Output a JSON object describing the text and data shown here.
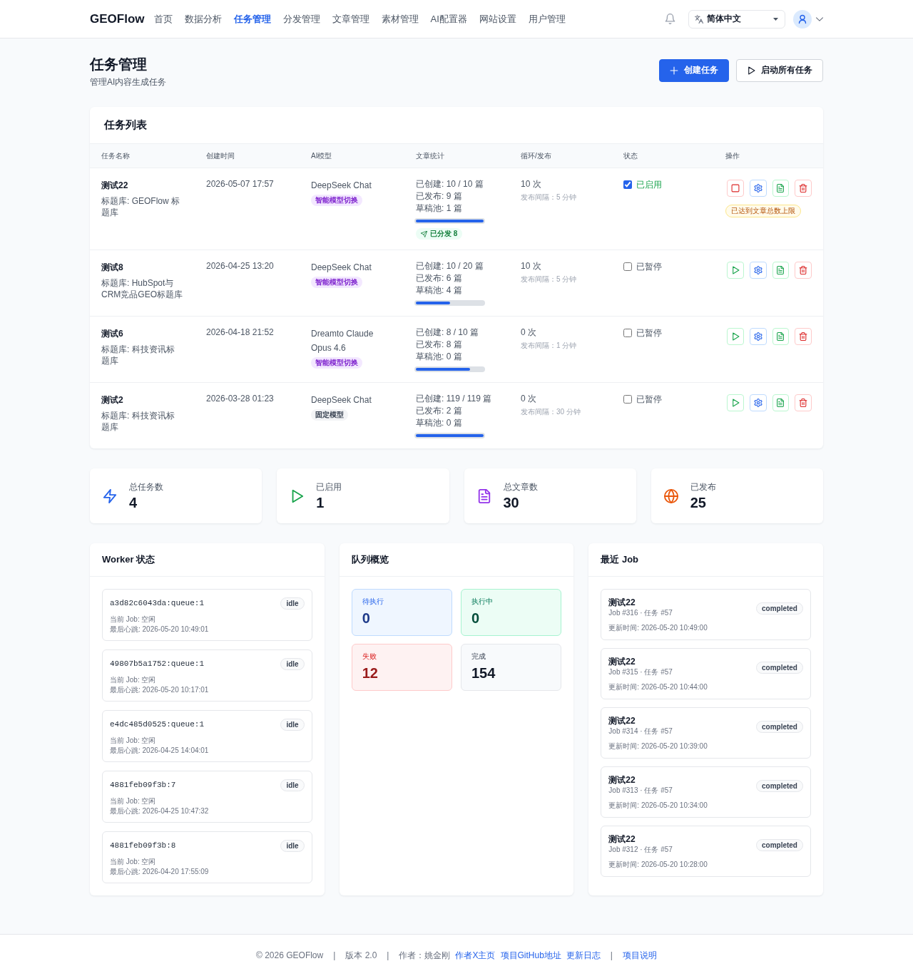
{
  "nav": {
    "logo": "GEOFlow",
    "items": [
      {
        "label": "首页",
        "selected": false
      },
      {
        "label": "数据分析",
        "selected": false
      },
      {
        "label": "任务管理",
        "selected": true
      },
      {
        "label": "分发管理",
        "selected": false
      },
      {
        "label": "文章管理",
        "selected": false
      },
      {
        "label": "素材管理",
        "selected": false
      },
      {
        "label": "AI配置器",
        "selected": false
      },
      {
        "label": "网站设置",
        "selected": false
      },
      {
        "label": "用户管理",
        "selected": false
      }
    ],
    "language": "简体中文"
  },
  "header": {
    "title": "任务管理",
    "subtitle": "管理AI内容生成任务",
    "buttons": [
      {
        "label": "创建任务",
        "kind": "primary"
      },
      {
        "label": "启动所有任务",
        "kind": "secondary"
      }
    ]
  },
  "task_table": {
    "title": "任务列表",
    "columns": [
      "任务名称",
      "创建时间",
      "AI模型",
      "文章统计",
      "循环/发布",
      "状态",
      "操作"
    ],
    "rows": [
      {
        "name": "测试22",
        "library": "标题库: GEOFlow 标题库",
        "created": "2026-05-07 17:57",
        "model": "DeepSeek Chat",
        "model_tag": {
          "label": "智能模型切换",
          "kind": "smart"
        },
        "stats": [
          "已创建: 10 / 10 篇",
          "已发布: 9 篇",
          "草稿池: 1 篇"
        ],
        "level": 1,
        "distributed": "已分发 8",
        "cycles": "10 次",
        "interval": "发布间隔：5 分钟",
        "enabled": true,
        "status": "已启用",
        "notice": "已达到文章总数上限"
      },
      {
        "name": "测试8",
        "library": "标题库: HubSpot与CRM竞品GEO标题库",
        "created": "2026-04-25 13:20",
        "model": "DeepSeek Chat",
        "model_tag": {
          "label": "智能模型切换",
          "kind": "smart"
        },
        "stats": [
          "已创建: 10 / 20 篇",
          "已发布: 6 篇",
          "草稿池: 4 篇"
        ],
        "level": 0.5,
        "cycles": "10 次",
        "interval": "发布间隔：5 分钟",
        "enabled": false,
        "status": "已暂停"
      },
      {
        "name": "测试6",
        "library": "标题库: 科技资讯标题库",
        "created": "2026-04-18 21:52",
        "model": "Dreamto Claude Opus 4.6",
        "model_tag": {
          "label": "智能模型切换",
          "kind": "smart"
        },
        "stats": [
          "已创建: 8 / 10 篇",
          "已发布: 8 篇",
          "草稿池: 0 篇"
        ],
        "level": 0.8,
        "cycles": "0 次",
        "interval": "发布间隔：1 分钟",
        "enabled": false,
        "status": "已暂停"
      },
      {
        "name": "测试2",
        "library": "标题库: 科技资讯标题库",
        "created": "2026-03-28 01:23",
        "model": "DeepSeek Chat",
        "model_tag": {
          "label": "固定模型",
          "kind": "fixed"
        },
        "stats": [
          "已创建: 119 / 119 篇",
          "已发布: 2 篇",
          "草稿池: 0 篇"
        ],
        "level": 1,
        "cycles": "0 次",
        "interval": "发布间隔：30 分钟",
        "enabled": false,
        "status": "已暂停"
      }
    ]
  },
  "summary_cards": [
    {
      "label": "总任务数",
      "value": "4",
      "kind": "tasks"
    },
    {
      "label": "已启用",
      "value": "1",
      "kind": "enabled"
    },
    {
      "label": "总文章数",
      "value": "30",
      "kind": "articles"
    },
    {
      "label": "已发布",
      "value": "25",
      "kind": "published"
    }
  ],
  "workers": {
    "title": "Worker 状态",
    "items": [
      {
        "id": "a3d82c6043da:queue:1",
        "state": "idle",
        "job": "当前 Job: 空闲",
        "heartbeat": "最后心跳: 2026-05-20 10:49:01"
      },
      {
        "id": "49807b5a1752:queue:1",
        "state": "idle",
        "job": "当前 Job: 空闲",
        "heartbeat": "最后心跳: 2026-05-20 10:17:01"
      },
      {
        "id": "e4dc485d0525:queue:1",
        "state": "idle",
        "job": "当前 Job: 空闲",
        "heartbeat": "最后心跳: 2026-04-25 14:04:01"
      },
      {
        "id": "4881feb09f3b:7",
        "state": "idle",
        "job": "当前 Job: 空闲",
        "heartbeat": "最后心跳: 2026-04-25 10:47:32"
      },
      {
        "id": "4881feb09f3b:8",
        "state": "idle",
        "job": "当前 Job: 空闲",
        "heartbeat": "最后心跳: 2026-04-20 17:55:09"
      }
    ]
  },
  "queue": {
    "title": "队列概览",
    "items": [
      {
        "label": "待执行",
        "value": "0",
        "kind": "pending"
      },
      {
        "label": "执行中",
        "value": "0",
        "kind": "running"
      },
      {
        "label": "失败",
        "value": "12",
        "kind": "failed"
      },
      {
        "label": "完成",
        "value": "154",
        "kind": "completed"
      }
    ]
  },
  "recent_jobs": {
    "title": "最近 Job",
    "items": [
      {
        "name": "测试22",
        "meta": "Job #316 · 任务 #57",
        "updated": "更新时间: 2026-05-20 10:49:00",
        "state": "completed"
      },
      {
        "name": "测试22",
        "meta": "Job #315 · 任务 #57",
        "updated": "更新时间: 2026-05-20 10:44:00",
        "state": "completed"
      },
      {
        "name": "测试22",
        "meta": "Job #314 · 任务 #57",
        "updated": "更新时间: 2026-05-20 10:39:00",
        "state": "completed"
      },
      {
        "name": "测试22",
        "meta": "Job #313 · 任务 #57",
        "updated": "更新时间: 2026-05-20 10:34:00",
        "state": "completed"
      },
      {
        "name": "测试22",
        "meta": "Job #312 · 任务 #57",
        "updated": "更新时间: 2026-05-20 10:28:00",
        "state": "completed"
      }
    ]
  },
  "footer": [
    {
      "kind": "text",
      "text": "© 2026 GEOFlow"
    },
    {
      "kind": "separator",
      "text": "|"
    },
    {
      "kind": "text",
      "text": "版本 2.0"
    },
    {
      "kind": "separator",
      "text": "|"
    },
    {
      "kind": "text",
      "text": "作者：姚金刚"
    },
    {
      "kind": "link",
      "text": "作者X主页"
    },
    {
      "kind": "link",
      "text": "项目GitHub地址"
    },
    {
      "kind": "link",
      "text": "更新日志"
    },
    {
      "kind": "separator",
      "text": "|"
    },
    {
      "kind": "link",
      "text": "项目说明"
    }
  ]
}
